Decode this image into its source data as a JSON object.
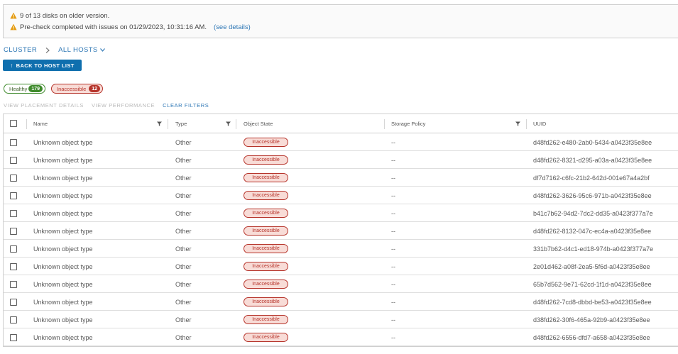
{
  "alerts": [
    {
      "icon": "warning-icon",
      "text": "9 of 13 disks on older version.",
      "link": ""
    },
    {
      "icon": "warning-icon",
      "text": "Pre-check completed with issues on 01/29/2023, 10:31:16 AM.",
      "link": "(see details)"
    }
  ],
  "breadcrumb": {
    "root": "CLUSTER",
    "current": "ALL HOSTS"
  },
  "back_button": {
    "arrow": "↑",
    "label": "BACK TO HOST LIST"
  },
  "filters": {
    "healthy": {
      "label": "Healthy",
      "count": "179"
    },
    "inaccessible": {
      "label": "Inaccessible",
      "count": "12"
    }
  },
  "actions": {
    "view_placement": "VIEW PLACEMENT DETAILS",
    "view_performance": "VIEW PERFORMANCE",
    "clear_filters": "CLEAR FILTERS"
  },
  "table": {
    "headers": {
      "name": "Name",
      "type": "Type",
      "state": "Object State",
      "policy": "Storage Policy",
      "uuid": "UUID"
    },
    "rows": [
      {
        "name": "Unknown object type",
        "type": "Other",
        "state": "Inaccessible",
        "policy": "--",
        "uuid": "d48fd262-e480-2ab0-5434-a0423f35e8ee"
      },
      {
        "name": "Unknown object type",
        "type": "Other",
        "state": "Inaccessible",
        "policy": "--",
        "uuid": "d48fd262-8321-d295-a03a-a0423f35e8ee"
      },
      {
        "name": "Unknown object type",
        "type": "Other",
        "state": "Inaccessible",
        "policy": "--",
        "uuid": "df7d7162-c6fc-21b2-642d-001e67a4a2bf"
      },
      {
        "name": "Unknown object type",
        "type": "Other",
        "state": "Inaccessible",
        "policy": "--",
        "uuid": "d48fd262-3626-95c6-971b-a0423f35e8ee"
      },
      {
        "name": "Unknown object type",
        "type": "Other",
        "state": "Inaccessible",
        "policy": "--",
        "uuid": "b41c7b62-94d2-7dc2-dd35-a0423f377a7e"
      },
      {
        "name": "Unknown object type",
        "type": "Other",
        "state": "Inaccessible",
        "policy": "--",
        "uuid": "d48fd262-8132-047c-ec4a-a0423f35e8ee"
      },
      {
        "name": "Unknown object type",
        "type": "Other",
        "state": "Inaccessible",
        "policy": "--",
        "uuid": "331b7b62-d4c1-ed18-974b-a0423f377a7e"
      },
      {
        "name": "Unknown object type",
        "type": "Other",
        "state": "Inaccessible",
        "policy": "--",
        "uuid": "2e01d462-a08f-2ea5-5f6d-a0423f35e8ee"
      },
      {
        "name": "Unknown object type",
        "type": "Other",
        "state": "Inaccessible",
        "policy": "--",
        "uuid": "65b7d562-9e71-62cd-1f1d-a0423f35e8ee"
      },
      {
        "name": "Unknown object type",
        "type": "Other",
        "state": "Inaccessible",
        "policy": "--",
        "uuid": "d48fd262-7cd8-dbbd-be53-a0423f35e8ee"
      },
      {
        "name": "Unknown object type",
        "type": "Other",
        "state": "Inaccessible",
        "policy": "--",
        "uuid": "d38fd262-30f6-465a-92b9-a0423f35e8ee"
      },
      {
        "name": "Unknown object type",
        "type": "Other",
        "state": "Inaccessible",
        "policy": "--",
        "uuid": "d48fd262-6556-dfd7-a658-a0423f35e8ee"
      }
    ]
  },
  "colors": {
    "accent": "#2e77b5",
    "primary_button": "#0f6fae",
    "warning": "#e49b0f",
    "healthy": "#3e8a2b",
    "danger": "#b6342b"
  }
}
